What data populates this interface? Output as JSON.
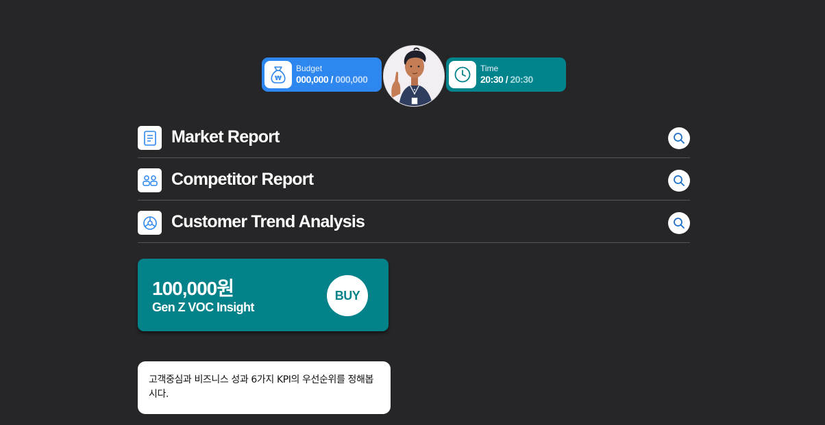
{
  "hud": {
    "budget": {
      "label": "Budget",
      "current": "000,000",
      "separator": " / ",
      "max": "000,000",
      "icon": "money-bag-won-icon",
      "color": "#2d87ee"
    },
    "time": {
      "label": "Time",
      "current": "20:30",
      "separator": " / ",
      "max": "20:30",
      "icon": "clock-icon",
      "color": "#02848c"
    },
    "avatar": "character-avatar"
  },
  "reports": [
    {
      "title": "Market Report",
      "icon": "document-icon",
      "action_icon": "search-icon"
    },
    {
      "title": "Competitor Report",
      "icon": "users-icon",
      "action_icon": "search-icon"
    },
    {
      "title": "Customer Trend Analysis",
      "icon": "chart-wheel-icon",
      "action_icon": "search-icon"
    }
  ],
  "offer": {
    "price": "100,000원",
    "name": "Gen Z VOC Insight",
    "buy_label": "BUY",
    "color": "#03828a"
  },
  "message": {
    "text": "고객중심과 비즈니스 성과 6가지 KPI의 우선순위를 정해봅시다."
  },
  "colors": {
    "background": "#262527",
    "icon_blue": "#2d87ee"
  }
}
